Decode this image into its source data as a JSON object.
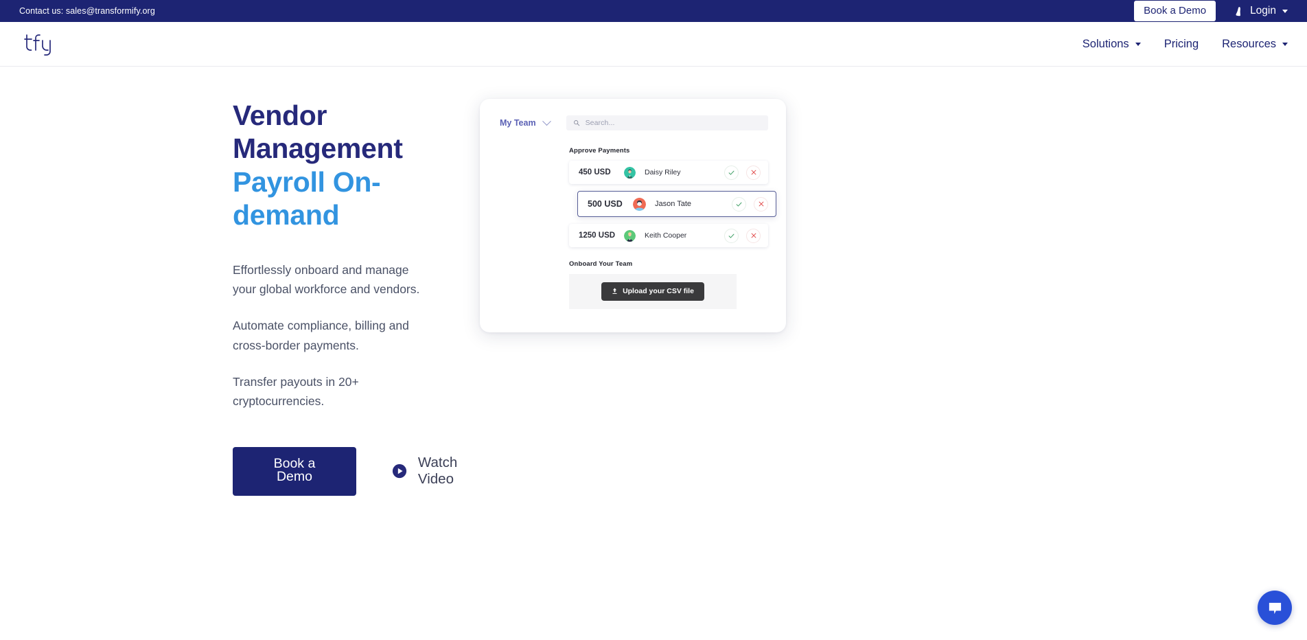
{
  "topbar": {
    "contact": "Contact us: sales@transformify.org",
    "demo_button": "Book a Demo",
    "login_label": "Login",
    "login_icon": "user-icon",
    "bg_color": "#1d2473"
  },
  "nav": {
    "logo_text": "tfy",
    "links": [
      {
        "label": "Solutions",
        "has_caret": true
      },
      {
        "label": "Pricing",
        "has_caret": false
      },
      {
        "label": "Resources",
        "has_caret": true
      }
    ]
  },
  "hero": {
    "heading_line1": "Vendor Management",
    "heading_line2": "Payroll On-demand",
    "heading_color1": "#26297a",
    "heading_color2": "#3294e0",
    "paragraphs": [
      "Effortlessly onboard and manage your global workforce and vendors.",
      "Automate compliance, billing and cross-border payments.",
      "Transfer payouts in 20+ cryptocurrencies."
    ],
    "primary_cta": "Book a Demo",
    "secondary_cta": "Watch Video",
    "secondary_cta_icon": "play-circle-icon"
  },
  "app_mock": {
    "team_selector": "My Team",
    "search_placeholder": "Search...",
    "search_value": "",
    "section_payments": "Approve Payments",
    "payments": [
      {
        "amount": "450 USD",
        "name": "Daisy Riley",
        "avatar_bg": "#34c3a4",
        "selected": false
      },
      {
        "amount": "500 USD",
        "name": "Jason Tate",
        "avatar_bg": "#ef6b55",
        "selected": true
      },
      {
        "amount": "1250 USD",
        "name": "Keith Cooper",
        "avatar_bg": "#5cc97a",
        "selected": false
      }
    ],
    "approve_icon": "check-icon",
    "reject_icon": "x-icon",
    "approve_color": "#3d9e63",
    "reject_color": "#e04646",
    "section_onboard": "Onboard Your Team",
    "upload_button": "Upload your CSV file",
    "upload_icon": "upload-icon"
  },
  "chat": {
    "icon": "chat-bubble-icon",
    "color": "#2950d8"
  }
}
